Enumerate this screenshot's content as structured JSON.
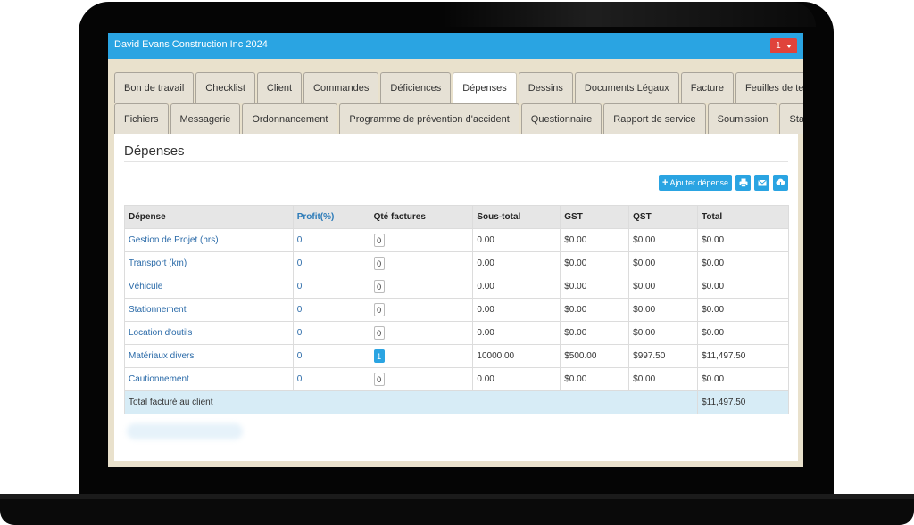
{
  "window": {
    "title": "David Evans Construction Inc 2024",
    "notification_count": "1"
  },
  "tabs_row1": [
    "Bon de travail",
    "Checklist",
    "Client",
    "Commandes",
    "Déficiences",
    "Dépenses",
    "Dessins",
    "Documents Légaux",
    "Facture",
    "Feuilles de temps"
  ],
  "tabs_row2": [
    "Fichiers",
    "Messagerie",
    "Ordonnancement",
    "Programme de prévention d'accident",
    "Questionnaire",
    "Rapport de service",
    "Soumission",
    "Statistiques"
  ],
  "active_tab": "Dépenses",
  "page": {
    "title": "Dépenses"
  },
  "toolbar": {
    "add_label": "Ajouter dépense",
    "icons": [
      "print-icon",
      "email-icon",
      "cloud-download-icon"
    ]
  },
  "table": {
    "headers": [
      "Dépense",
      "Profit(%)",
      "Qté factures",
      "Sous-total",
      "GST",
      "QST",
      "Total"
    ],
    "rows": [
      {
        "name": "Gestion de Projet (hrs)",
        "profit": "0",
        "qty": "0",
        "subtotal": "0.00",
        "gst": "$0.00",
        "qst": "$0.00",
        "total": "$0.00"
      },
      {
        "name": "Transport (km)",
        "profit": "0",
        "qty": "0",
        "subtotal": "0.00",
        "gst": "$0.00",
        "qst": "$0.00",
        "total": "$0.00"
      },
      {
        "name": "Véhicule",
        "profit": "0",
        "qty": "0",
        "subtotal": "0.00",
        "gst": "$0.00",
        "qst": "$0.00",
        "total": "$0.00"
      },
      {
        "name": "Stationnement",
        "profit": "0",
        "qty": "0",
        "subtotal": "0.00",
        "gst": "$0.00",
        "qst": "$0.00",
        "total": "$0.00"
      },
      {
        "name": "Location d'outils",
        "profit": "0",
        "qty": "0",
        "subtotal": "0.00",
        "gst": "$0.00",
        "qst": "$0.00",
        "total": "$0.00"
      },
      {
        "name": "Matériaux divers",
        "profit": "0",
        "qty": "1",
        "subtotal": "10000.00",
        "gst": "$500.00",
        "qst": "$997.50",
        "total": "$11,497.50"
      },
      {
        "name": "Cautionnement",
        "profit": "0",
        "qty": "0",
        "subtotal": "0.00",
        "gst": "$0.00",
        "qst": "$0.00",
        "total": "$0.00"
      }
    ],
    "footer": {
      "label": "Total facturé au client",
      "total": "$11,497.50"
    }
  },
  "colors": {
    "accent": "#2aa4e2",
    "badge": "#e0433b",
    "total_row": "#d7ecf6"
  }
}
